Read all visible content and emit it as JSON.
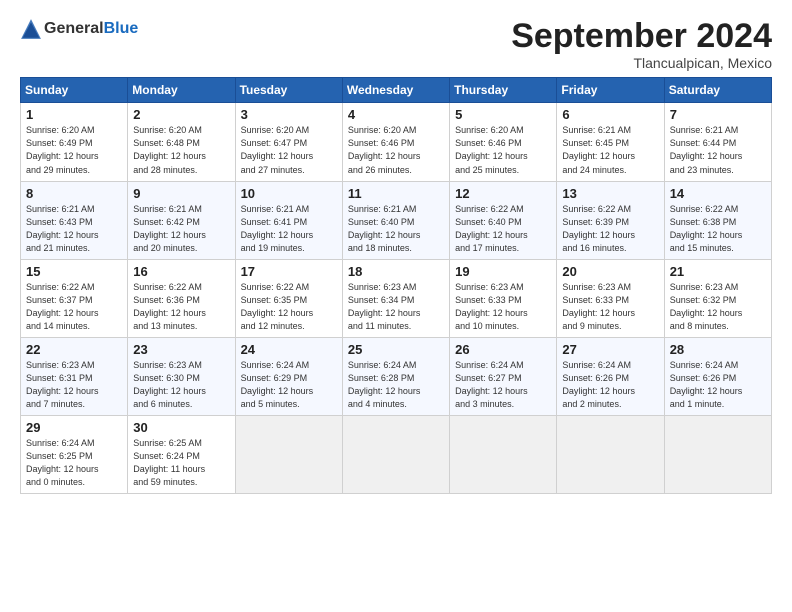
{
  "header": {
    "logo_general": "General",
    "logo_blue": "Blue",
    "month": "September 2024",
    "location": "Tlancualpican, Mexico"
  },
  "weekdays": [
    "Sunday",
    "Monday",
    "Tuesday",
    "Wednesday",
    "Thursday",
    "Friday",
    "Saturday"
  ],
  "weeks": [
    [
      {
        "day": "1",
        "details": "Sunrise: 6:20 AM\nSunset: 6:49 PM\nDaylight: 12 hours\nand 29 minutes."
      },
      {
        "day": "2",
        "details": "Sunrise: 6:20 AM\nSunset: 6:48 PM\nDaylight: 12 hours\nand 28 minutes."
      },
      {
        "day": "3",
        "details": "Sunrise: 6:20 AM\nSunset: 6:47 PM\nDaylight: 12 hours\nand 27 minutes."
      },
      {
        "day": "4",
        "details": "Sunrise: 6:20 AM\nSunset: 6:46 PM\nDaylight: 12 hours\nand 26 minutes."
      },
      {
        "day": "5",
        "details": "Sunrise: 6:20 AM\nSunset: 6:46 PM\nDaylight: 12 hours\nand 25 minutes."
      },
      {
        "day": "6",
        "details": "Sunrise: 6:21 AM\nSunset: 6:45 PM\nDaylight: 12 hours\nand 24 minutes."
      },
      {
        "day": "7",
        "details": "Sunrise: 6:21 AM\nSunset: 6:44 PM\nDaylight: 12 hours\nand 23 minutes."
      }
    ],
    [
      {
        "day": "8",
        "details": "Sunrise: 6:21 AM\nSunset: 6:43 PM\nDaylight: 12 hours\nand 21 minutes."
      },
      {
        "day": "9",
        "details": "Sunrise: 6:21 AM\nSunset: 6:42 PM\nDaylight: 12 hours\nand 20 minutes."
      },
      {
        "day": "10",
        "details": "Sunrise: 6:21 AM\nSunset: 6:41 PM\nDaylight: 12 hours\nand 19 minutes."
      },
      {
        "day": "11",
        "details": "Sunrise: 6:21 AM\nSunset: 6:40 PM\nDaylight: 12 hours\nand 18 minutes."
      },
      {
        "day": "12",
        "details": "Sunrise: 6:22 AM\nSunset: 6:40 PM\nDaylight: 12 hours\nand 17 minutes."
      },
      {
        "day": "13",
        "details": "Sunrise: 6:22 AM\nSunset: 6:39 PM\nDaylight: 12 hours\nand 16 minutes."
      },
      {
        "day": "14",
        "details": "Sunrise: 6:22 AM\nSunset: 6:38 PM\nDaylight: 12 hours\nand 15 minutes."
      }
    ],
    [
      {
        "day": "15",
        "details": "Sunrise: 6:22 AM\nSunset: 6:37 PM\nDaylight: 12 hours\nand 14 minutes."
      },
      {
        "day": "16",
        "details": "Sunrise: 6:22 AM\nSunset: 6:36 PM\nDaylight: 12 hours\nand 13 minutes."
      },
      {
        "day": "17",
        "details": "Sunrise: 6:22 AM\nSunset: 6:35 PM\nDaylight: 12 hours\nand 12 minutes."
      },
      {
        "day": "18",
        "details": "Sunrise: 6:23 AM\nSunset: 6:34 PM\nDaylight: 12 hours\nand 11 minutes."
      },
      {
        "day": "19",
        "details": "Sunrise: 6:23 AM\nSunset: 6:33 PM\nDaylight: 12 hours\nand 10 minutes."
      },
      {
        "day": "20",
        "details": "Sunrise: 6:23 AM\nSunset: 6:33 PM\nDaylight: 12 hours\nand 9 minutes."
      },
      {
        "day": "21",
        "details": "Sunrise: 6:23 AM\nSunset: 6:32 PM\nDaylight: 12 hours\nand 8 minutes."
      }
    ],
    [
      {
        "day": "22",
        "details": "Sunrise: 6:23 AM\nSunset: 6:31 PM\nDaylight: 12 hours\nand 7 minutes."
      },
      {
        "day": "23",
        "details": "Sunrise: 6:23 AM\nSunset: 6:30 PM\nDaylight: 12 hours\nand 6 minutes."
      },
      {
        "day": "24",
        "details": "Sunrise: 6:24 AM\nSunset: 6:29 PM\nDaylight: 12 hours\nand 5 minutes."
      },
      {
        "day": "25",
        "details": "Sunrise: 6:24 AM\nSunset: 6:28 PM\nDaylight: 12 hours\nand 4 minutes."
      },
      {
        "day": "26",
        "details": "Sunrise: 6:24 AM\nSunset: 6:27 PM\nDaylight: 12 hours\nand 3 minutes."
      },
      {
        "day": "27",
        "details": "Sunrise: 6:24 AM\nSunset: 6:26 PM\nDaylight: 12 hours\nand 2 minutes."
      },
      {
        "day": "28",
        "details": "Sunrise: 6:24 AM\nSunset: 6:26 PM\nDaylight: 12 hours\nand 1 minute."
      }
    ],
    [
      {
        "day": "29",
        "details": "Sunrise: 6:24 AM\nSunset: 6:25 PM\nDaylight: 12 hours\nand 0 minutes."
      },
      {
        "day": "30",
        "details": "Sunrise: 6:25 AM\nSunset: 6:24 PM\nDaylight: 11 hours\nand 59 minutes."
      },
      {
        "day": "",
        "details": ""
      },
      {
        "day": "",
        "details": ""
      },
      {
        "day": "",
        "details": ""
      },
      {
        "day": "",
        "details": ""
      },
      {
        "day": "",
        "details": ""
      }
    ]
  ]
}
